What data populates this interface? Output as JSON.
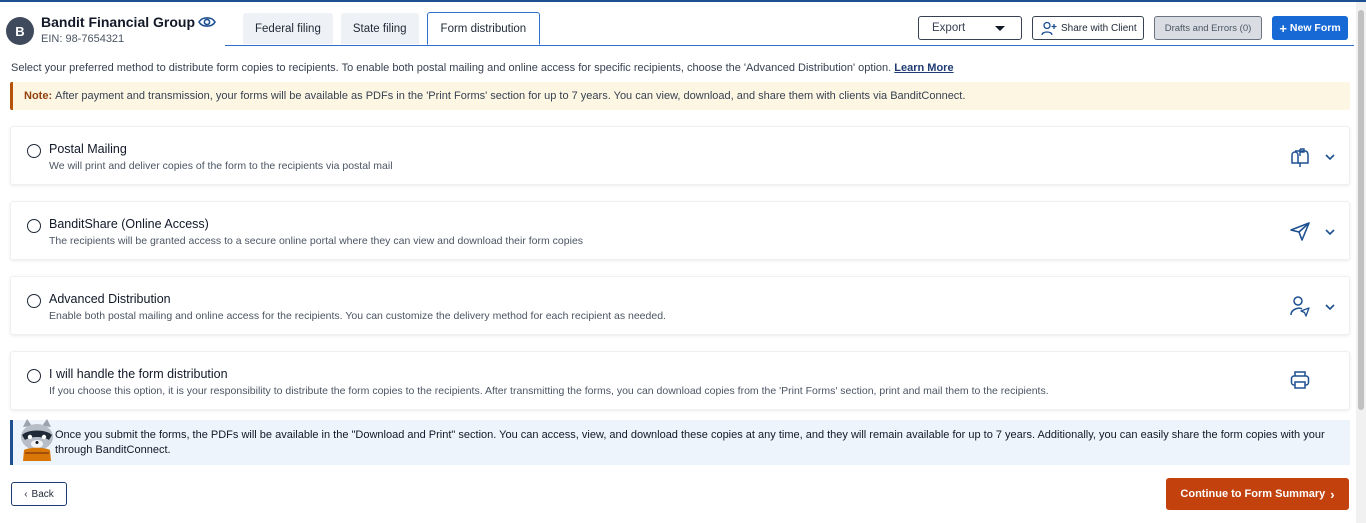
{
  "header": {
    "avatar_letter": "B",
    "company_name": "Bandit Financial Group",
    "ein": "EIN: 98-7654321",
    "tabs": [
      {
        "label": "Federal filing"
      },
      {
        "label": "State filing"
      },
      {
        "label": "Form distribution"
      }
    ],
    "export_label": "Export",
    "share_label": "Share with Client",
    "drafts_label": "Drafts and Errors (0)",
    "new_form_label": "New Form"
  },
  "intro": {
    "text": "Select your preferred method to distribute form copies to recipients. To enable both postal mailing and online access for specific recipients, choose the 'Advanced Distribution' option.",
    "link": "Learn More"
  },
  "note": {
    "label": "Note:",
    "text": "After payment and transmission, your forms will be available as PDFs in the 'Print Forms' section for up to 7 years. You can view, download, and share them with clients via BanditConnect."
  },
  "options": [
    {
      "title": "Postal Mailing",
      "description": "We will print and deliver copies of the form to the recipients via postal mail",
      "icon": "mailbox-icon"
    },
    {
      "title": "BanditShare (Online Access)",
      "description": "The recipients will be granted access to a secure online portal where they can view and download their form copies",
      "icon": "send-icon"
    },
    {
      "title": "Advanced Distribution",
      "description": "Enable both postal mailing and online access for the recipients. You can customize the delivery method for each recipient as needed.",
      "icon": "user-send-icon"
    },
    {
      "title": "I will handle the form distribution",
      "description": "If you choose this option, it is your responsibility to distribute the form copies to the recipients. After transmitting the forms, you can download copies from the 'Print Forms' section, print and mail them to the recipients.",
      "icon": "printer-icon"
    }
  ],
  "info": {
    "text": "Once you submit the forms, the PDFs will be available in the \"Download and Print\" section. You can access, view, and download these copies at any time, and they will remain available for up to 7 years. Additionally, you can easily share the form copies with your through BanditConnect."
  },
  "footer": {
    "back_label": "Back",
    "continue_label": "Continue to Form Summary"
  },
  "colors": {
    "primary": "#1769d6",
    "accent": "#c2410c",
    "navy": "#1d4f91"
  }
}
